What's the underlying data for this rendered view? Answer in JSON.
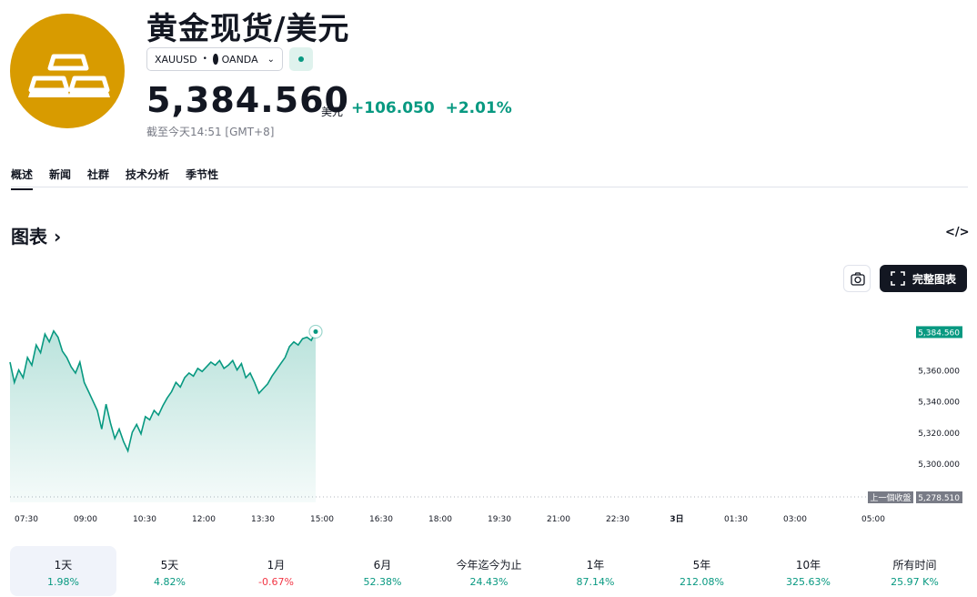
{
  "header": {
    "title": "黄金现货/美元",
    "symbol": "XAUUSD",
    "exchange": "OANDA",
    "price": "5,384.560",
    "currency": "美元",
    "change_abs": "+106.050",
    "change_pct": "+2.01%",
    "as_of": "截至今天14:51 [GMT+8]"
  },
  "tabs": [
    "概述",
    "新闻",
    "社群",
    "技术分析",
    "季节性"
  ],
  "section": {
    "title": "图表",
    "chevron": "›",
    "embed_icon": "</>"
  },
  "buttons": {
    "full_chart": "完整图表"
  },
  "icons": {
    "logo": "gold-bars-icon",
    "exchange": "oanda-icon",
    "market_status": "market-open-dot-icon",
    "embed": "code-embed-icon",
    "snapshot": "camera-icon",
    "fullscreen": "fullscreen-icon"
  },
  "colors": {
    "accent_up": "#089981",
    "accent_down": "#f23645",
    "logo_bg": "#d89b00"
  },
  "chart_data": {
    "type": "area",
    "x_ticks": [
      "07:30",
      "09:00",
      "10:30",
      "12:00",
      "13:30",
      "15:00",
      "16:30",
      "18:00",
      "19:30",
      "21:00",
      "22:30",
      "3日",
      "01:30",
      "03:00",
      "05:00"
    ],
    "y_ticks": [
      "5,300.000",
      "5,320.000",
      "5,340.000",
      "5,360.000"
    ],
    "ylim": [
      5275,
      5400
    ],
    "last_price_label": "5,384.560",
    "prev_close_label": "上一個收盤",
    "prev_close_value": "5,278.510",
    "series": [
      {
        "values": [
          5365,
          5352,
          5360,
          5355,
          5368,
          5363,
          5376,
          5371,
          5383,
          5378,
          5385,
          5381,
          5372,
          5368,
          5362,
          5358,
          5365,
          5352,
          5346,
          5340,
          5334,
          5322,
          5338,
          5326,
          5316,
          5322,
          5314,
          5308,
          5320,
          5325,
          5319,
          5330,
          5328,
          5334,
          5331,
          5337,
          5342,
          5346,
          5352,
          5349,
          5355,
          5358,
          5356,
          5361,
          5359,
          5362,
          5365,
          5363,
          5366,
          5361,
          5363,
          5366,
          5360,
          5364,
          5355,
          5358,
          5352,
          5345,
          5348,
          5351,
          5356,
          5360,
          5364,
          5368,
          5375,
          5378,
          5376,
          5380,
          5381,
          5379,
          5384.56
        ]
      }
    ]
  },
  "ranges": [
    {
      "label": "1天",
      "value": "1.98%",
      "dir": "pos",
      "active": true
    },
    {
      "label": "5天",
      "value": "4.82%",
      "dir": "pos",
      "active": false
    },
    {
      "label": "1月",
      "value": "-0.67%",
      "dir": "neg",
      "active": false
    },
    {
      "label": "6月",
      "value": "52.38%",
      "dir": "pos",
      "active": false
    },
    {
      "label": "今年迄今为止",
      "value": "24.43%",
      "dir": "pos",
      "active": false
    },
    {
      "label": "1年",
      "value": "87.14%",
      "dir": "pos",
      "active": false
    },
    {
      "label": "5年",
      "value": "212.08%",
      "dir": "pos",
      "active": false
    },
    {
      "label": "10年",
      "value": "325.63%",
      "dir": "pos",
      "active": false
    },
    {
      "label": "所有时间",
      "value": "25.97 K%",
      "dir": "pos",
      "active": false
    }
  ]
}
